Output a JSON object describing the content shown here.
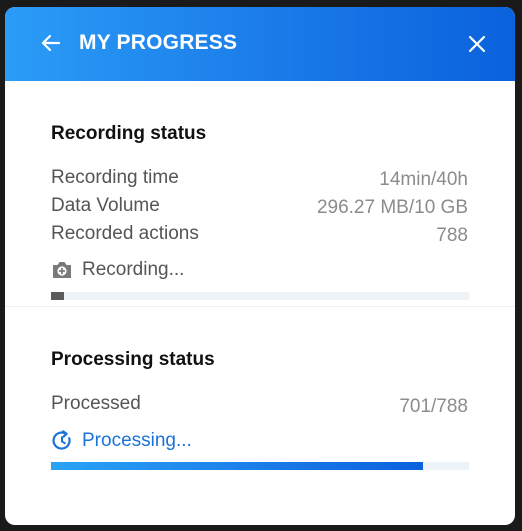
{
  "header": {
    "title": "MY PROGRESS",
    "back_icon": "arrow-left-icon",
    "close_icon": "close-icon"
  },
  "recording": {
    "title": "Recording status",
    "rows": [
      {
        "label": "Recording time",
        "value": "14min/40h"
      },
      {
        "label": "Data Volume",
        "value": "296.27 MB/10 GB"
      },
      {
        "label": "Recorded actions",
        "value": "788"
      }
    ],
    "status_text": "Recording...",
    "status_icon": "camera-icon",
    "progress_fraction": 0.03
  },
  "processing": {
    "title": "Processing status",
    "rows": [
      {
        "label": "Processed",
        "value": "701/788"
      }
    ],
    "status_text": "Processing...",
    "status_icon": "refresh-clock-icon",
    "progress_fraction": 0.89
  },
  "colors": {
    "header_gradient_start": "#2a9cf7",
    "header_gradient_end": "#0a62dd",
    "recording_status_text": "#555555",
    "processing_status_text": "#1a73d8",
    "recording_fill": "#5b5b5b"
  }
}
